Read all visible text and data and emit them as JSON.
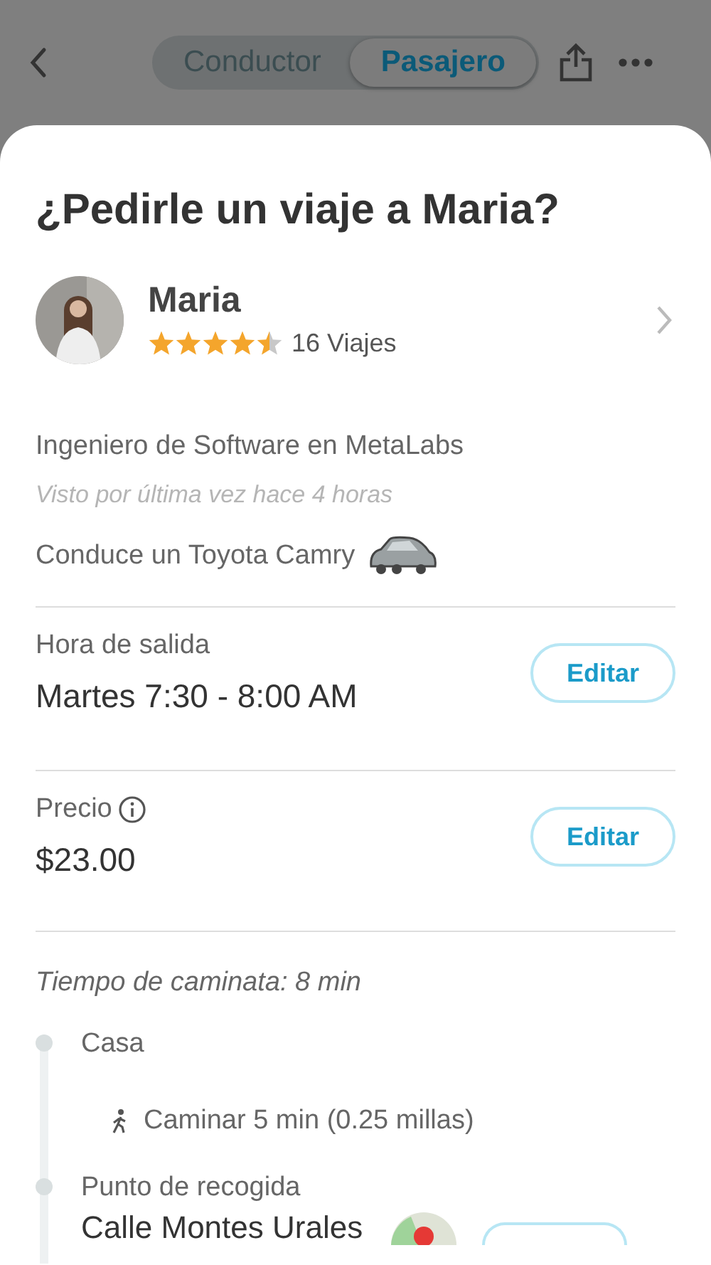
{
  "nav": {
    "tabs": [
      {
        "label": "Conductor",
        "selected": false
      },
      {
        "label": "Pasajero",
        "selected": true
      }
    ]
  },
  "title": "¿Pedirle un viaje a Maria?",
  "profile": {
    "name": "Maria",
    "stars": 4.5,
    "trips": "16 Viajes"
  },
  "job": "Ingeniero de Software en MetaLabs",
  "last_seen": "Visto por última vez hace 4 horas",
  "car": "Conduce un Toyota Camry",
  "sections": [
    {
      "label": "Hora de salida",
      "value": "Martes 7:30 - 8:00 AM",
      "info": false,
      "button": "Editar"
    },
    {
      "label": "Precio",
      "value": "$23.00",
      "info": true,
      "button": "Editar"
    }
  ],
  "walk_time": "Tiempo de caminata: 8 min",
  "route": [
    {
      "kind": "stop",
      "label": "Casa"
    },
    {
      "kind": "walk",
      "label": "Caminar 5 min (0.25 millas)"
    },
    {
      "kind": "stop",
      "label": "Punto de recogida",
      "value": "Calle Montes Urales"
    }
  ]
}
